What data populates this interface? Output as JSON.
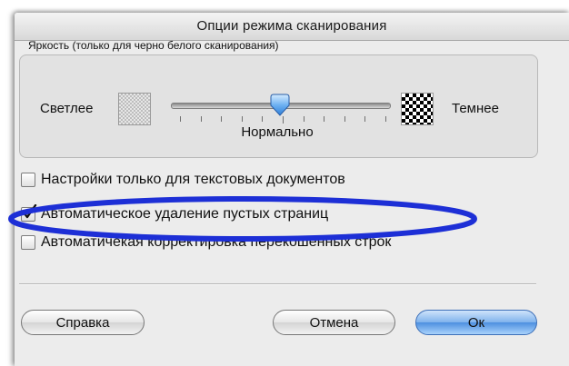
{
  "dialog": {
    "title": "Опции режима сканирования"
  },
  "brightness": {
    "group_label": "Яркость (только для черно белого сканирования)",
    "light_label": "Светлее",
    "dark_label": "Темнее",
    "value_label": "Нормально",
    "slider_position": 0.5,
    "tick_count": 11
  },
  "options": [
    {
      "label": "Настройки только для текстовых документов",
      "checked": false
    },
    {
      "label": "Автоматическое удаление пустых страниц",
      "checked": true
    },
    {
      "label": "Автоматичекая корректировка перекошенных строк",
      "checked": false
    }
  ],
  "buttons": {
    "help": "Справка",
    "cancel": "Отмена",
    "ok": "Ок"
  },
  "colors": {
    "default_button": "#4d8fe0",
    "annotation_ellipse": "#1d2fd6"
  }
}
